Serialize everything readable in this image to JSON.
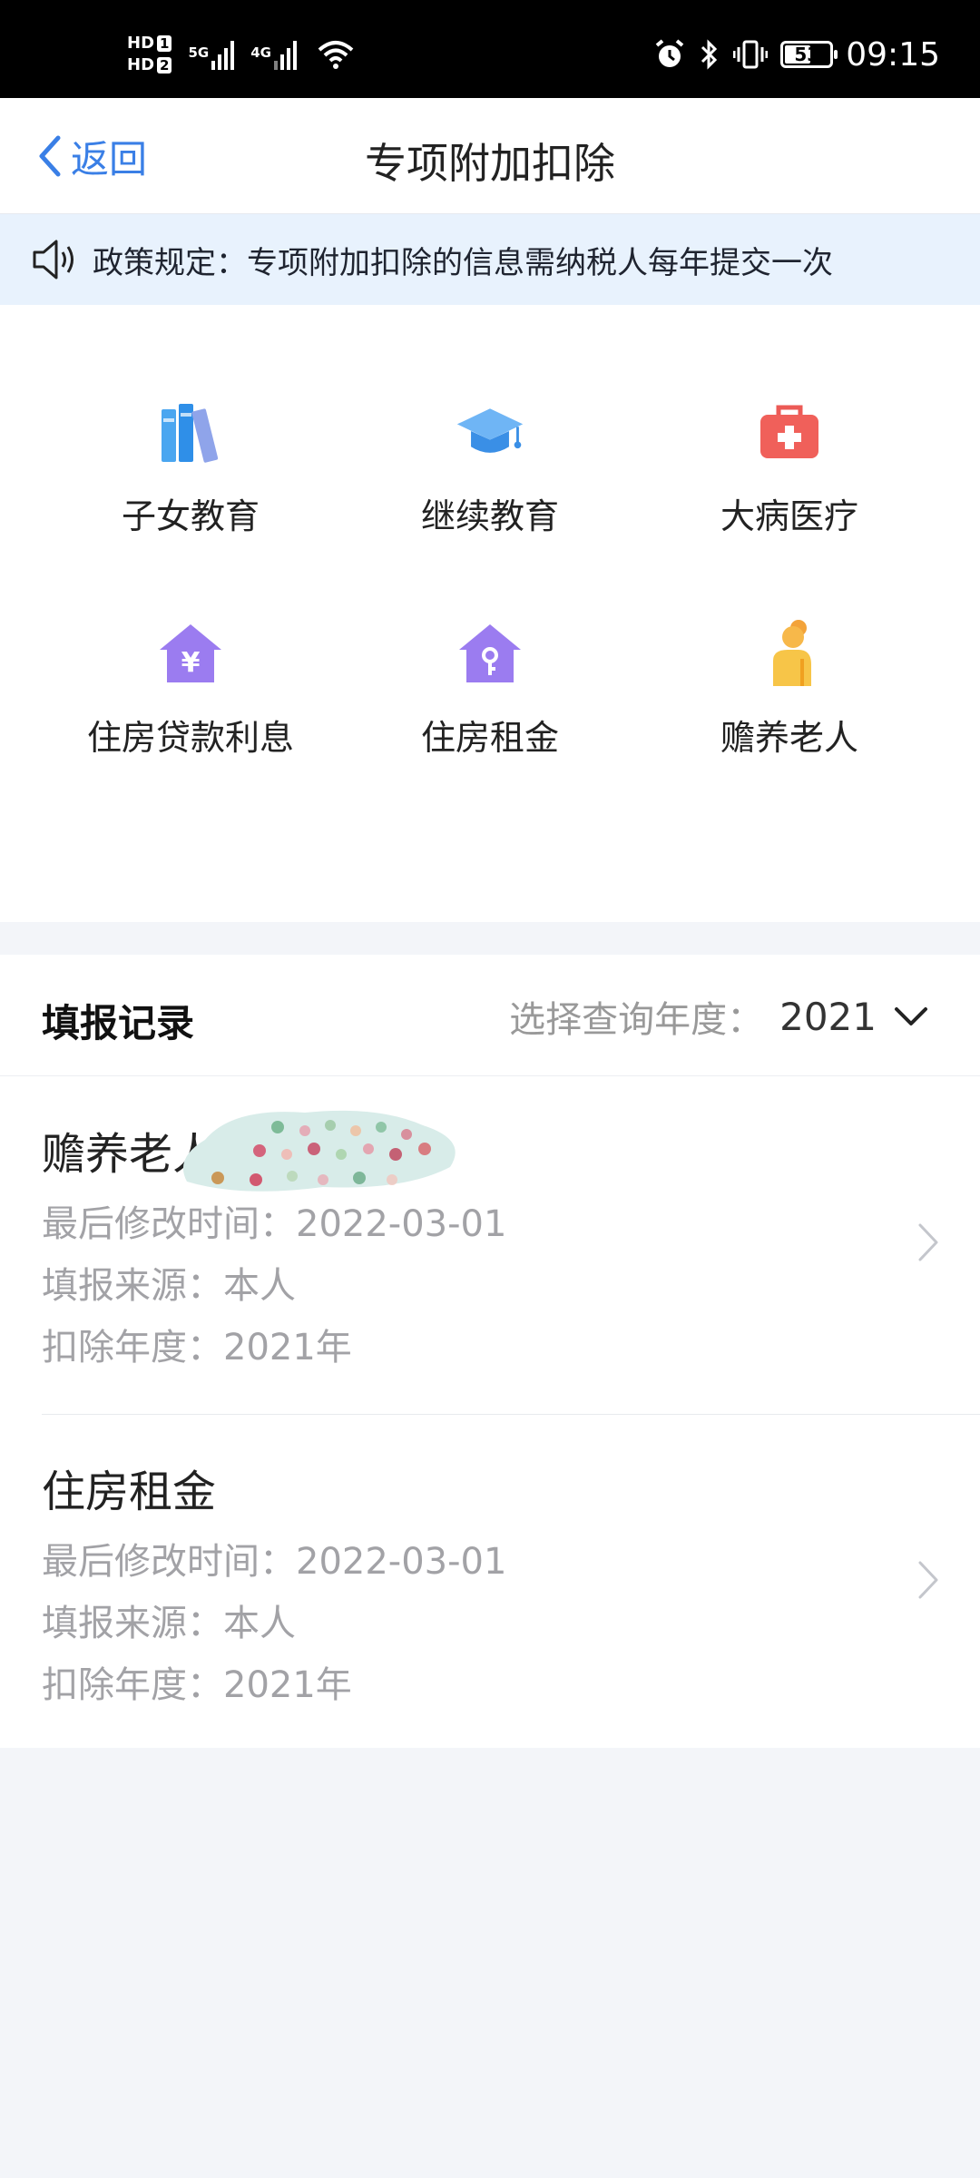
{
  "status_bar": {
    "sim1": "HD",
    "sim1_num": "1",
    "sim2": "HD",
    "sim2_num": "2",
    "net1": "5G",
    "net2": "4G",
    "battery": "53",
    "battery_level": 0.53,
    "time": "09:15"
  },
  "nav": {
    "back_label": "返回",
    "title": "专项附加扣除"
  },
  "notice": {
    "text": "政策规定：专项附加扣除的信息需纳税人每年提交一次"
  },
  "categories": [
    {
      "label": "子女教育",
      "icon": "books-icon"
    },
    {
      "label": "继续教育",
      "icon": "graduation-cap-icon"
    },
    {
      "label": "大病医疗",
      "icon": "first-aid-kit-icon"
    },
    {
      "label": "住房贷款利息",
      "icon": "house-yuan-icon"
    },
    {
      "label": "住房租金",
      "icon": "house-key-icon"
    },
    {
      "label": "赡养老人",
      "icon": "elderly-person-icon"
    }
  ],
  "records": {
    "title": "填报记录",
    "year_label": "选择查询年度：",
    "year_value": "2021",
    "items": [
      {
        "name": "赡养老人",
        "modified": "最后修改时间：2022-03-01",
        "source": "填报来源：本人",
        "year": "扣除年度：2021年"
      },
      {
        "name": "住房租金",
        "modified": "最后修改时间：2022-03-01",
        "source": "填报来源：本人",
        "year": "扣除年度：2021年"
      }
    ]
  },
  "colors": {
    "accent": "#3a7fe6",
    "notice_bg": "#e8f2fd",
    "page_bg": "#f3f5f9"
  }
}
